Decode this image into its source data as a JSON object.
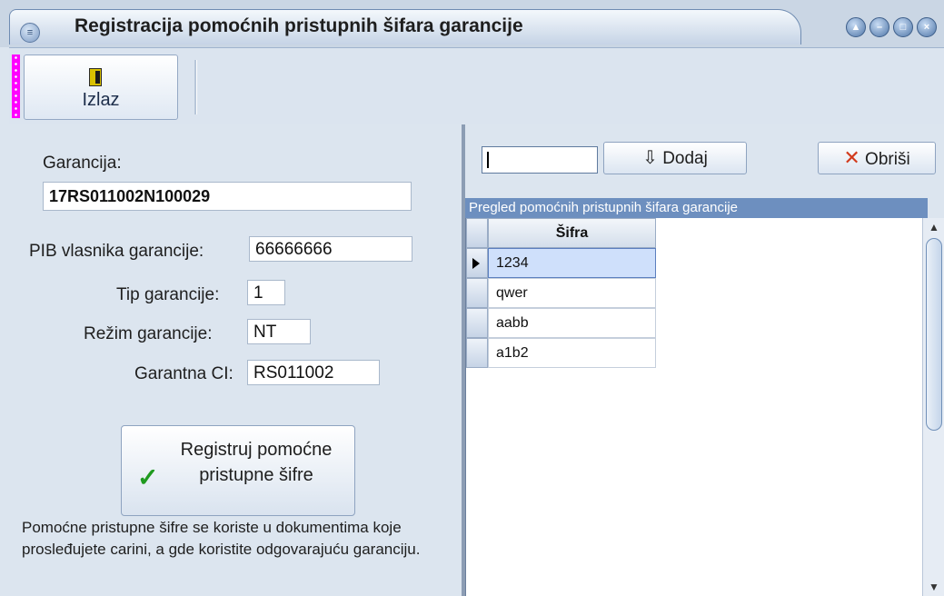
{
  "window": {
    "title": "Registracija pomoćnih pristupnih šifara garancije",
    "controls": [
      "help",
      "minimize",
      "maximize",
      "close"
    ]
  },
  "toolbar": {
    "exit_label": "Izlaz",
    "exit_icon": "door-exit-icon"
  },
  "form": {
    "garancija_label": "Garancija:",
    "garancija_value": "17RS011002N100029",
    "pib_label": "PIB vlasnika garancije:",
    "pib_value": "66666666",
    "tip_label": "Tip garancije:",
    "tip_value": "1",
    "rezim_label": "Režim garancije:",
    "rezim_value": "NT",
    "ci_label": "Garantna CI:",
    "ci_value": "RS011002",
    "register_label_line1": "Registruj pomoćne",
    "register_label_line2": "pristupne šifre",
    "note": "Pomoćne pristupne šifre se koriste u dokumentima koje prosleđujete carini, a gde koristite odgovarajuću garanciju."
  },
  "codes_panel": {
    "input_value": "",
    "add_label": "Dodaj",
    "delete_label": "Obriši",
    "grid_title": "Pregled pomoćnih pristupnih šifara garancije",
    "column_header": "Šifra",
    "rows": [
      "1234",
      "qwer",
      "aabb",
      "a1b2"
    ],
    "selected_index": 0
  },
  "colors": {
    "title_bg": "#cad6e4",
    "panel_bg": "#dce5ef",
    "grid_header_bg": "#6d8fbf",
    "selected_row": "#cfe0fb",
    "grip": "#ff00ff"
  }
}
